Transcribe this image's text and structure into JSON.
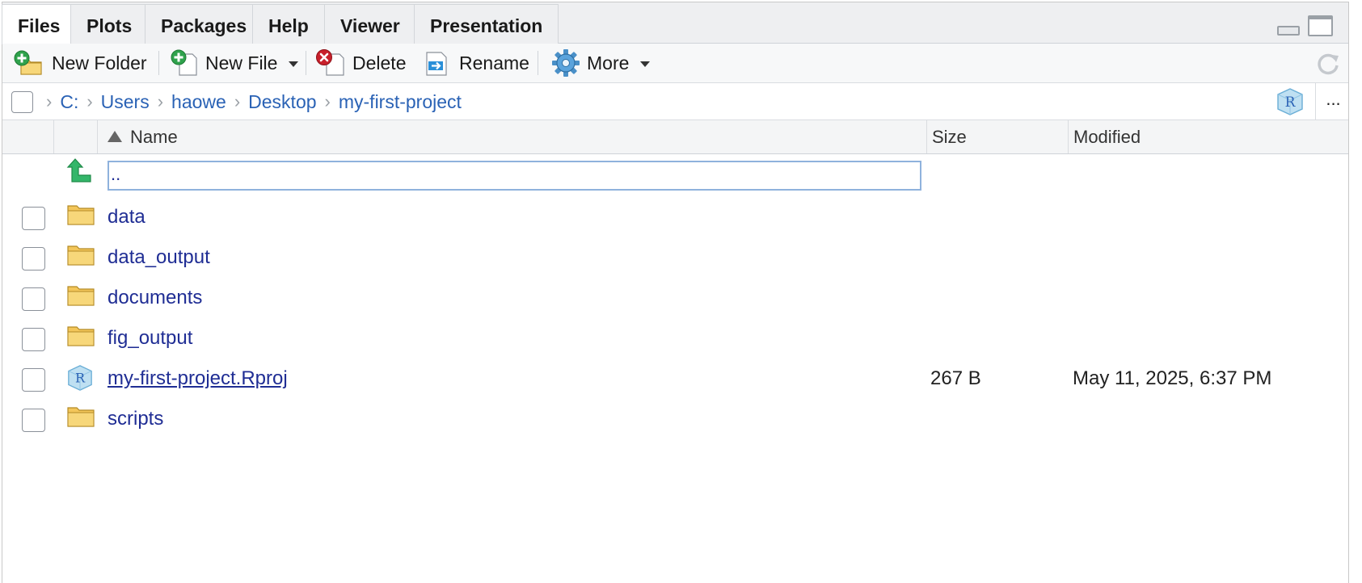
{
  "tabs": [
    {
      "label": "Files",
      "active": true
    },
    {
      "label": "Plots"
    },
    {
      "label": "Packages"
    },
    {
      "label": "Help"
    },
    {
      "label": "Viewer"
    },
    {
      "label": "Presentation"
    }
  ],
  "toolbar": {
    "new_folder": "New Folder",
    "new_file": "New File",
    "delete": "Delete",
    "rename": "Rename",
    "more": "More"
  },
  "breadcrumb": [
    "C:",
    "Users",
    "haowe",
    "Desktop",
    "my-first-project"
  ],
  "breadcrumb_more": "...",
  "table": {
    "columns": {
      "name": "Name",
      "size": "Size",
      "modified": "Modified"
    },
    "parent_dir": "..",
    "rows": [
      {
        "name": "data",
        "type": "folder",
        "size": "",
        "modified": ""
      },
      {
        "name": "data_output",
        "type": "folder",
        "size": "",
        "modified": ""
      },
      {
        "name": "documents",
        "type": "folder",
        "size": "",
        "modified": ""
      },
      {
        "name": "fig_output",
        "type": "folder",
        "size": "",
        "modified": ""
      },
      {
        "name": "my-first-project.Rproj",
        "type": "rproj",
        "size": "267 B",
        "modified": "May 11, 2025, 6:37 PM"
      },
      {
        "name": "scripts",
        "type": "folder",
        "size": "",
        "modified": ""
      }
    ]
  },
  "colors": {
    "link": "#1f2d94",
    "breadcrumb_link": "#2a62b5",
    "folder": "#f3c65a",
    "accent_green": "#2fa24c",
    "delete_red": "#c8202b"
  }
}
